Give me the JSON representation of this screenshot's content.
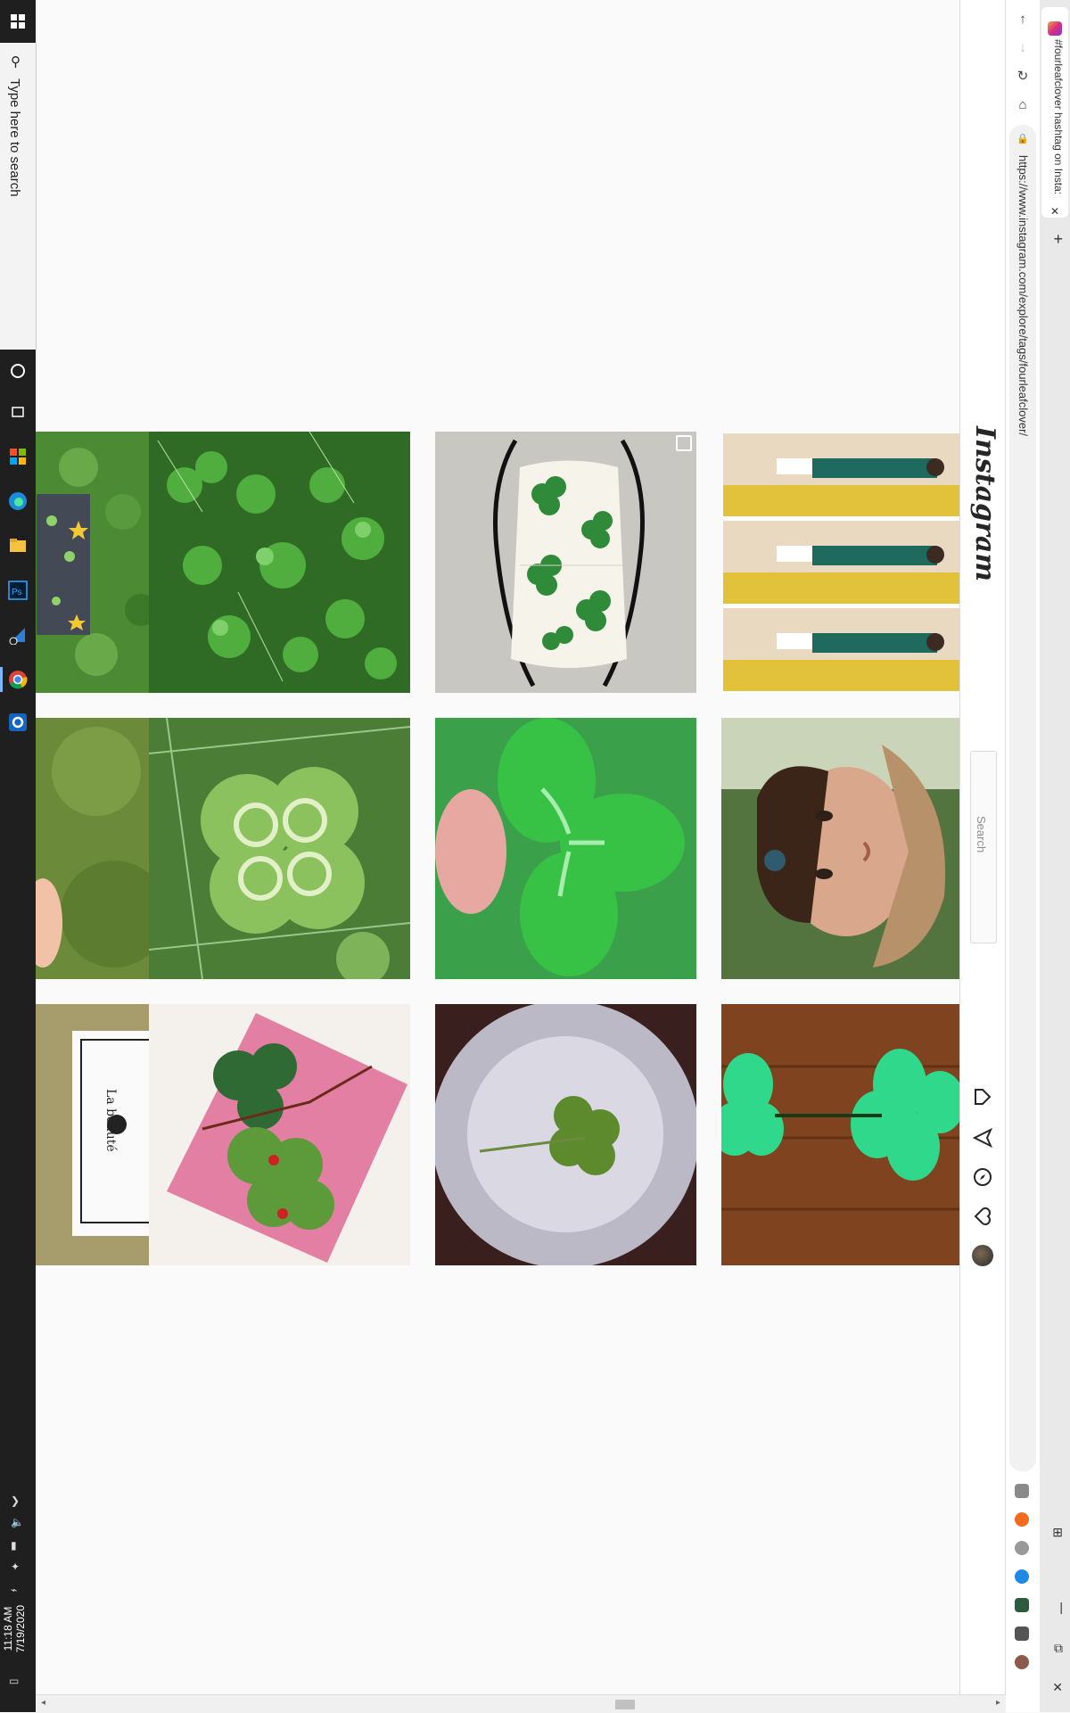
{
  "taskbar": {
    "search_placeholder": "Type here to search",
    "time": "11:18 AM",
    "date": "7/19/2020"
  },
  "browser": {
    "tab_title": "#fourleafclover hashtag on Insta:",
    "url": "https://www.instagram.com/explore/tags/fourleafclover/"
  },
  "instagram": {
    "logo": "Instagram",
    "search_placeholder": "Search"
  },
  "posts": [
    {
      "name": "post-clover-patch-cropped",
      "desc": "clover patch with star sticker"
    },
    {
      "name": "post-clover-field",
      "desc": "clover field"
    },
    {
      "name": "post-clover-mask",
      "desc": "shamrock face mask"
    },
    {
      "name": "post-triple-photo",
      "desc": "triple repeated photo"
    },
    {
      "name": "post-grass-finger",
      "desc": "grass with finger"
    },
    {
      "name": "post-four-leaf-clover",
      "desc": "four leaf clover in grass"
    },
    {
      "name": "post-clover-closeup",
      "desc": "clover closeup green"
    },
    {
      "name": "post-woman-portrait",
      "desc": "woman portrait with hat"
    },
    {
      "name": "post-la-beaute-card",
      "desc": "la beaute card"
    },
    {
      "name": "post-clover-card-pink",
      "desc": "felt clover card on pink"
    },
    {
      "name": "post-clover-in-dish",
      "desc": "clover in dish"
    },
    {
      "name": "post-balloon-clover",
      "desc": "green balloon clover on wood floor"
    }
  ],
  "card_text": "La beauté",
  "colors": {
    "taskbar": "#1f1f1f",
    "ig_border": "#dbdbdb",
    "clover_green": "#3bb34a"
  }
}
